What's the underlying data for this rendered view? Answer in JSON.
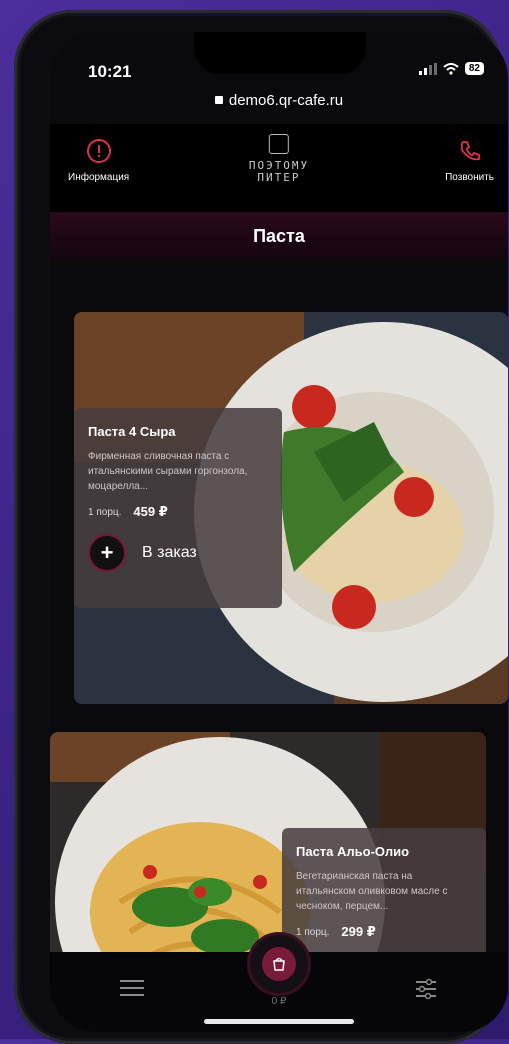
{
  "status": {
    "time": "10:21",
    "battery": "82"
  },
  "browser": {
    "url": "demo6.qr-cafe.ru"
  },
  "header": {
    "info_label": "Информация",
    "call_label": "Позвонить",
    "logo_line1": "ПОЭТОМУ",
    "logo_line2": "ПИТЕР"
  },
  "category": {
    "title": "Паста"
  },
  "dishes": [
    {
      "name": "Паста 4 Сыра",
      "description": "Фирменная сливочная паста с итальянскими сырами горгонзола, моцарелла...",
      "portion": "1 порц.",
      "price": "459 ₽",
      "order_label": "В заказ"
    },
    {
      "name": "Паста Альо-Олио",
      "description": "Вегетарианская паста на итальянском оливковом масле с чесноком, перцем...",
      "portion": "1 порц.",
      "price": "299 ₽"
    }
  ],
  "bottom_nav": {
    "cart_total": "0 ₽"
  },
  "colors": {
    "accent": "#7a1b3c",
    "call_icon": "#e0314e",
    "info_icon": "#e0314e"
  }
}
